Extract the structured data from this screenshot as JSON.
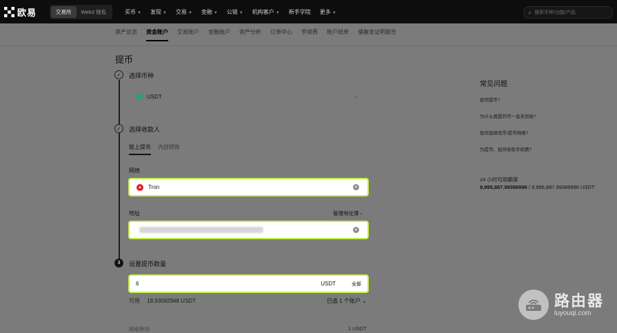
{
  "topnav": {
    "logo_text": "欧易",
    "modes": [
      "交易所",
      "Web3 钱包"
    ],
    "items": [
      "买币",
      "发现",
      "交易",
      "金融",
      "公链",
      "机构客户",
      "新手学院",
      "更多"
    ],
    "search_placeholder": "搜索币种/功能/产品"
  },
  "subtabs": [
    "资产总览",
    "资金账户",
    "交易账户",
    "金融账户",
    "资产分析",
    "订单中心",
    "手续费",
    "账户结单",
    "储备金证明报告"
  ],
  "page_title": "提币",
  "steps": {
    "step1": "选择币种",
    "coin": "USDT",
    "step2": "选择收款人",
    "recv_tabs": [
      "链上提币",
      "内部转账"
    ],
    "network_label": "网络",
    "network_value": "Tron",
    "address_label": "地址",
    "manage_label": "管理地址簿 ›",
    "step3_num": "3",
    "step3": "设置提币数量",
    "amount_value": "6",
    "amount_unit": "USDT",
    "all_label": "全部",
    "available_label": "可用",
    "available_value": "18.93092948 USDT",
    "account_select": "已选 1 个账户 ⌄",
    "fee_label": "网络费用",
    "fee_value": "1 USDT"
  },
  "faq": {
    "title": "常见问题",
    "items": [
      "如何提币?",
      "为什么我提的币一直未到账?",
      "如何选择充币/提币网络?",
      "为提币、如何收取手续费?"
    ],
    "limit_label": "24 小时可用额度",
    "limit_value_bold": "9,995,887.99386996",
    "limit_value_rest": " / 9,995,887.99386996 USDT"
  },
  "watermark": {
    "title": "路由器",
    "url": "luyouqi.com"
  }
}
